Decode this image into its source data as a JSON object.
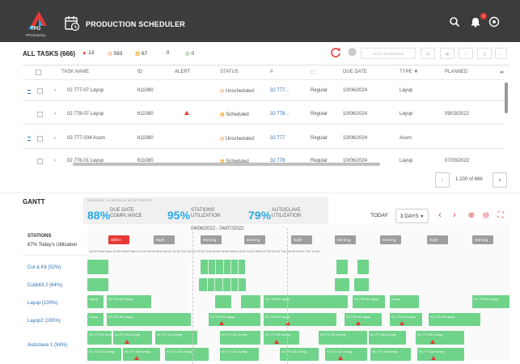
{
  "app": {
    "logo_text": "TPO",
    "logo_sub": "TPOindustry",
    "title": "PRODUCTION SCHEDULER",
    "notifications": "5"
  },
  "toolbar": {
    "title": "ALL TASKS (666)",
    "stats": [
      {
        "label": "13",
        "icon": "warning-icon",
        "color": "#e53935"
      },
      {
        "label": "593",
        "icon": "unscheduled-icon",
        "color": "#ef6c00"
      },
      {
        "label": "67",
        "icon": "scheduled-icon",
        "color": "#f9a825"
      },
      {
        "label": "0",
        "icon": "in-progress-icon",
        "color": "#8bc34a"
      },
      {
        "label": "0",
        "icon": "complete-icon",
        "color": "#43a047"
      }
    ],
    "auto_schedule": "AUTO SCHEDULE"
  },
  "table": {
    "headers": [
      "TASK NAME",
      "ID",
      "ALERT",
      "STATUS",
      "#",
      "",
      "DUE DATE",
      "TYPE",
      "PLANNED"
    ],
    "rows": [
      {
        "name": "02 777-07 Layup",
        "id": "611080",
        "status": "Unscheduled",
        "num": "32 777...",
        "type_ic": "Regular",
        "due": "10/06/2024",
        "type": "Layup",
        "planned": ""
      },
      {
        "name": "02 778-07 Layup",
        "id": "611080",
        "status": "Scheduled",
        "num": "32 778...",
        "type_ic": "Regular",
        "due": "10/06/2024",
        "type": "Layup",
        "planned": "09/03/2022"
      },
      {
        "name": "02-777-034 Assm",
        "id": "611080",
        "status": "Unscheduled",
        "num": "32 777",
        "type_ic": "Regular",
        "due": "10/06/2024",
        "type": "Assm",
        "planned": ""
      },
      {
        "name": "02 778-01 Layup",
        "id": "611080",
        "status": "Scheduled",
        "num": "32 778",
        "type_ic": "Regular",
        "due": "10/06/2024",
        "type": "Layup",
        "planned": "07/03/2022"
      }
    ]
  },
  "pager": {
    "text": "1-200 of 666"
  },
  "gantt": {
    "label": "GANTT",
    "kpi_header": "ASSIGNED / SCHEDULED WORK ORDERS",
    "kpis": [
      {
        "value": "88%",
        "label_1": "DUE DATE",
        "label_2": "COMPLIANCE"
      },
      {
        "value": "95%",
        "label_1": "STATIONS",
        "label_2": "UTILIZATION"
      },
      {
        "value": "79%",
        "label_1": "AUTOCLAVE",
        "label_2": "UTILIZATION"
      }
    ],
    "today": "TODAY",
    "range": "3 DAYS",
    "stations_header": "STATIONS",
    "stations_sub": "87%  Today's Utilization",
    "dates": "04/06/2022 - 04/07/2022",
    "shifts": [
      {
        "label": "Shift A",
        "color": "#e53935"
      },
      {
        "label": "Night",
        "color": "#9e9e9e"
      },
      {
        "label": "Morning",
        "color": "#9e9e9e"
      },
      {
        "label": "Evening",
        "color": "#9e9e9e"
      },
      {
        "label": "Night",
        "color": "#9e9e9e"
      },
      {
        "label": "Morning",
        "color": "#9e9e9e"
      },
      {
        "label": "Evening",
        "color": "#9e9e9e"
      },
      {
        "label": "Night",
        "color": "#9e9e9e"
      },
      {
        "label": "Morning",
        "color": "#9e9e9e"
      }
    ],
    "times": "16:00 Wed  Mon 10:00  06:00 Wed 14:00  10:00 Mon 18:00  14:00 Tue 22:00  22:00 Thu 06:00  06:00 Wed 14:00  14:00 Wed 22:00  22:00 Thu 06:00  06:00 Thu 14:00",
    "stations": [
      {
        "name": "Cut & Kit (52%)"
      },
      {
        "name": "Cut&Kit 2 (64%)"
      },
      {
        "name": "Layup (100%)"
      },
      {
        "name": "Layup2 (100%)"
      },
      {
        "name": "Autoclave 1 (94%)"
      }
    ],
    "bar_labels": {
      "layup": "Layup",
      "wo": "02-778-09 Layup",
      "cure": "02-777-34 Curing"
    }
  }
}
